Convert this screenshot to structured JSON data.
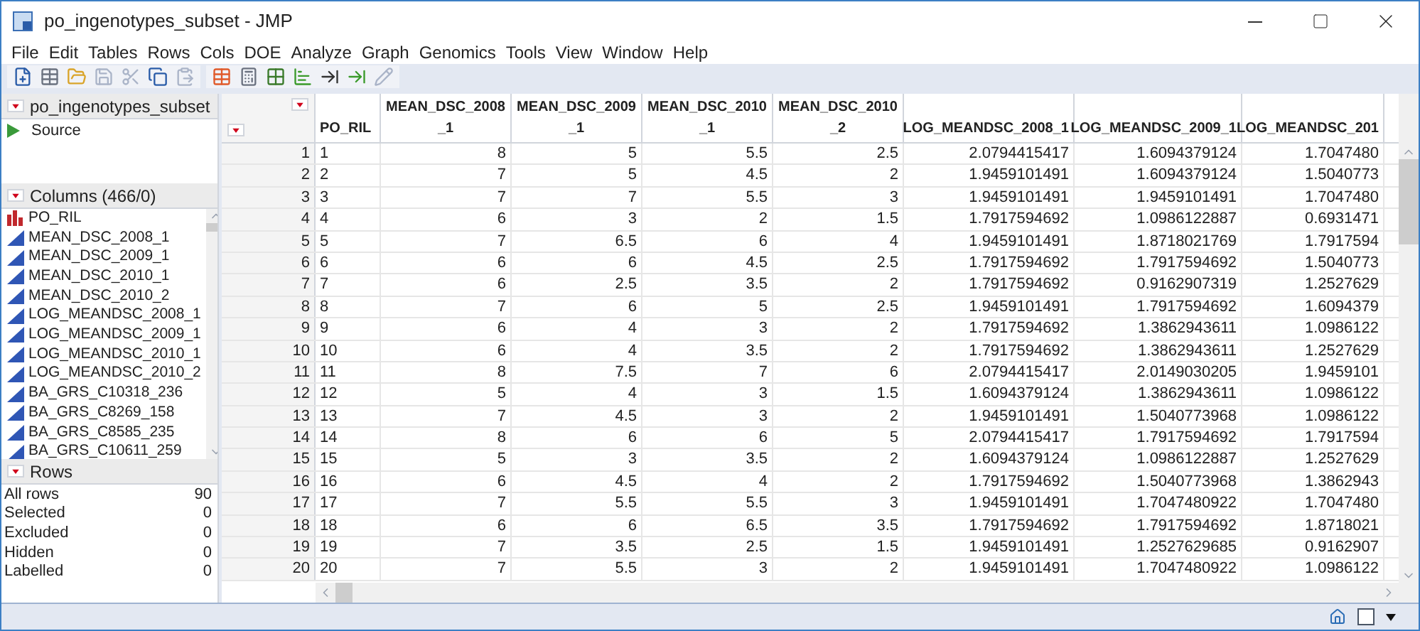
{
  "window": {
    "title": "po_ingenotypes_subset - JMP"
  },
  "menu": [
    "File",
    "Edit",
    "Tables",
    "Rows",
    "Cols",
    "DOE",
    "Analyze",
    "Graph",
    "Genomics",
    "Tools",
    "View",
    "Window",
    "Help"
  ],
  "table_panel": {
    "title": "po_ingenotypes_subset",
    "scripts": [
      "Source"
    ]
  },
  "columns_panel": {
    "title": "Columns (466/0)",
    "items": [
      {
        "name": "PO_RIL",
        "kind": "nominal"
      },
      {
        "name": "MEAN_DSC_2008_1",
        "kind": "continuous"
      },
      {
        "name": "MEAN_DSC_2009_1",
        "kind": "continuous"
      },
      {
        "name": "MEAN_DSC_2010_1",
        "kind": "continuous"
      },
      {
        "name": "MEAN_DSC_2010_2",
        "kind": "continuous"
      },
      {
        "name": "LOG_MEANDSC_2008_1",
        "kind": "continuous"
      },
      {
        "name": "LOG_MEANDSC_2009_1",
        "kind": "continuous"
      },
      {
        "name": "LOG_MEANDSC_2010_1",
        "kind": "continuous"
      },
      {
        "name": "LOG_MEANDSC_2010_2",
        "kind": "continuous"
      },
      {
        "name": "BA_GRS_C10318_236",
        "kind": "continuous"
      },
      {
        "name": "BA_GRS_C8269_158",
        "kind": "continuous"
      },
      {
        "name": "BA_GRS_C8585_235",
        "kind": "continuous"
      },
      {
        "name": "BA_GRS_C10611_259",
        "kind": "continuous"
      }
    ]
  },
  "rows_panel": {
    "title": "Rows",
    "items": [
      {
        "label": "All rows",
        "value": "90"
      },
      {
        "label": "Selected",
        "value": "0"
      },
      {
        "label": "Excluded",
        "value": "0"
      },
      {
        "label": "Hidden",
        "value": "0"
      },
      {
        "label": "Labelled",
        "value": "0"
      }
    ]
  },
  "table": {
    "columns": [
      {
        "lines": [
          "PO_RIL"
        ],
        "kind": "nominal"
      },
      {
        "lines": [
          "MEAN_DSC_2008",
          "_1"
        ],
        "kind": "continuous"
      },
      {
        "lines": [
          "MEAN_DSC_2009",
          "_1"
        ],
        "kind": "continuous"
      },
      {
        "lines": [
          "MEAN_DSC_2010",
          "_1"
        ],
        "kind": "continuous"
      },
      {
        "lines": [
          "MEAN_DSC_2010",
          "_2"
        ],
        "kind": "continuous"
      },
      {
        "lines": [
          "LOG_MEANDSC_2008_1"
        ],
        "kind": "continuous"
      },
      {
        "lines": [
          "LOG_MEANDSC_2009_1"
        ],
        "kind": "continuous"
      },
      {
        "lines": [
          "LOG_MEANDSC_201"
        ],
        "kind": "continuous"
      }
    ],
    "rows": [
      {
        "number": "1",
        "cells": [
          "1",
          "8",
          "5",
          "5.5",
          "2.5",
          "2.0794415417",
          "1.6094379124",
          "1.7047480"
        ]
      },
      {
        "number": "2",
        "cells": [
          "2",
          "7",
          "5",
          "4.5",
          "2",
          "1.9459101491",
          "1.6094379124",
          "1.5040773"
        ]
      },
      {
        "number": "3",
        "cells": [
          "3",
          "7",
          "7",
          "5.5",
          "3",
          "1.9459101491",
          "1.9459101491",
          "1.7047480"
        ]
      },
      {
        "number": "4",
        "cells": [
          "4",
          "6",
          "3",
          "2",
          "1.5",
          "1.7917594692",
          "1.0986122887",
          "0.6931471"
        ]
      },
      {
        "number": "5",
        "cells": [
          "5",
          "7",
          "6.5",
          "6",
          "4",
          "1.9459101491",
          "1.8718021769",
          "1.7917594"
        ]
      },
      {
        "number": "6",
        "cells": [
          "6",
          "6",
          "6",
          "4.5",
          "2.5",
          "1.7917594692",
          "1.7917594692",
          "1.5040773"
        ]
      },
      {
        "number": "7",
        "cells": [
          "7",
          "6",
          "2.5",
          "3.5",
          "2",
          "1.7917594692",
          "0.9162907319",
          "1.2527629"
        ]
      },
      {
        "number": "8",
        "cells": [
          "8",
          "7",
          "6",
          "5",
          "2.5",
          "1.9459101491",
          "1.7917594692",
          "1.6094379"
        ]
      },
      {
        "number": "9",
        "cells": [
          "9",
          "6",
          "4",
          "3",
          "2",
          "1.7917594692",
          "1.3862943611",
          "1.0986122"
        ]
      },
      {
        "number": "10",
        "cells": [
          "10",
          "6",
          "4",
          "3.5",
          "2",
          "1.7917594692",
          "1.3862943611",
          "1.2527629"
        ]
      },
      {
        "number": "11",
        "cells": [
          "11",
          "8",
          "7.5",
          "7",
          "6",
          "2.0794415417",
          "2.0149030205",
          "1.9459101"
        ]
      },
      {
        "number": "12",
        "cells": [
          "12",
          "5",
          "4",
          "3",
          "1.5",
          "1.6094379124",
          "1.3862943611",
          "1.0986122"
        ]
      },
      {
        "number": "13",
        "cells": [
          "13",
          "7",
          "4.5",
          "3",
          "2",
          "1.9459101491",
          "1.5040773968",
          "1.0986122"
        ]
      },
      {
        "number": "14",
        "cells": [
          "14",
          "8",
          "6",
          "6",
          "5",
          "2.0794415417",
          "1.7917594692",
          "1.7917594"
        ]
      },
      {
        "number": "15",
        "cells": [
          "15",
          "5",
          "3",
          "3.5",
          "2",
          "1.6094379124",
          "1.0986122887",
          "1.2527629"
        ]
      },
      {
        "number": "16",
        "cells": [
          "16",
          "6",
          "4.5",
          "4",
          "2",
          "1.7917594692",
          "1.5040773968",
          "1.3862943"
        ]
      },
      {
        "number": "17",
        "cells": [
          "17",
          "7",
          "5.5",
          "5.5",
          "3",
          "1.9459101491",
          "1.7047480922",
          "1.7047480"
        ]
      },
      {
        "number": "18",
        "cells": [
          "18",
          "6",
          "6",
          "6.5",
          "3.5",
          "1.7917594692",
          "1.7917594692",
          "1.8718021"
        ]
      },
      {
        "number": "19",
        "cells": [
          "19",
          "7",
          "3.5",
          "2.5",
          "1.5",
          "1.9459101491",
          "1.2527629685",
          "0.9162907"
        ]
      },
      {
        "number": "20",
        "cells": [
          "20",
          "7",
          "5.5",
          "3",
          "2",
          "1.9459101491",
          "1.7047480922",
          "1.0986122"
        ]
      }
    ]
  }
}
